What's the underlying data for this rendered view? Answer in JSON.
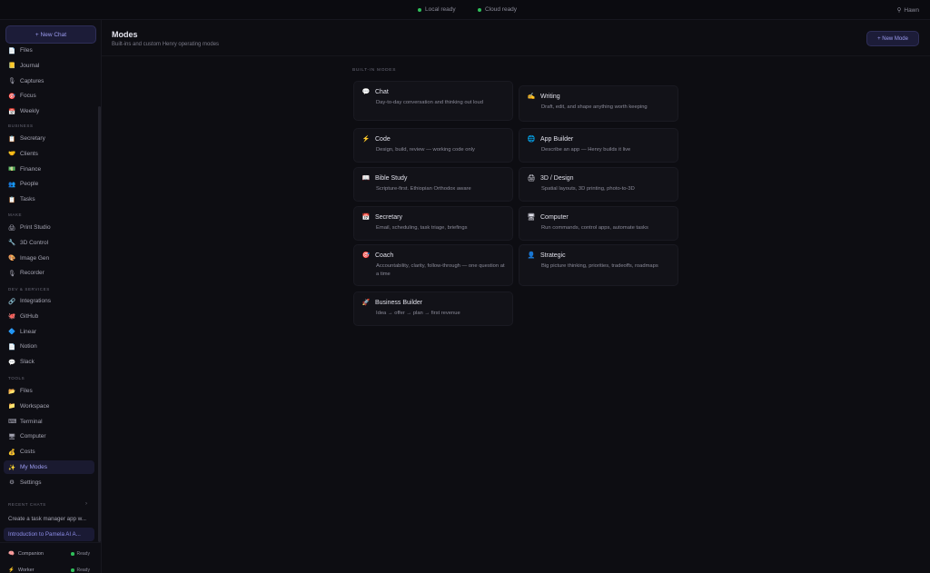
{
  "topbar": {
    "local_status": "Local ready",
    "cloud_status": "Cloud ready",
    "user": "Hawn",
    "status_color": "#2fbf5a"
  },
  "sidebar": {
    "new_chat": "+ New Chat",
    "top_items": [
      {
        "icon": "file-icon",
        "glyph": "📄",
        "label": "Files"
      },
      {
        "icon": "journal-icon",
        "glyph": "📒",
        "label": "Journal"
      },
      {
        "icon": "captures-icon",
        "glyph": "🎙",
        "label": "Captures"
      },
      {
        "icon": "focus-icon",
        "glyph": "🎯",
        "label": "Focus"
      },
      {
        "icon": "calendar-icon",
        "glyph": "📅",
        "label": "Weekly"
      }
    ],
    "business_label": "BUSINESS",
    "business_items": [
      {
        "icon": "secretary-icon",
        "glyph": "📋",
        "label": "Secretary"
      },
      {
        "icon": "handshake-icon",
        "glyph": "🤝",
        "label": "Clients"
      },
      {
        "icon": "finance-icon",
        "glyph": "💵",
        "label": "Finance"
      },
      {
        "icon": "people-icon",
        "glyph": "👥",
        "label": "People"
      },
      {
        "icon": "tasks-icon",
        "glyph": "📋",
        "label": "Tasks"
      }
    ],
    "make_label": "MAKE",
    "make_items": [
      {
        "icon": "printer-icon",
        "glyph": "🖨",
        "label": "Print Studio"
      },
      {
        "icon": "wrench-icon",
        "glyph": "🔧",
        "label": "3D Control"
      },
      {
        "icon": "image-icon",
        "glyph": "🎨",
        "label": "Image Gen"
      },
      {
        "icon": "microphone-icon",
        "glyph": "🎙",
        "label": "Recorder"
      }
    ],
    "dev_label": "DEV & SERVICES",
    "dev_items": [
      {
        "icon": "link-icon",
        "glyph": "🔗",
        "label": "Integrations"
      },
      {
        "icon": "github-icon",
        "glyph": "🐙",
        "label": "GitHub"
      },
      {
        "icon": "linear-icon",
        "glyph": "🔷",
        "label": "Linear"
      },
      {
        "icon": "notion-icon",
        "glyph": "📄",
        "label": "Notion"
      },
      {
        "icon": "slack-icon",
        "glyph": "💬",
        "label": "Slack"
      }
    ],
    "tools_label": "TOOLS",
    "tools_items": [
      {
        "icon": "files-icon",
        "glyph": "📂",
        "label": "Files"
      },
      {
        "icon": "folder-icon",
        "glyph": "📁",
        "label": "Workspace"
      },
      {
        "icon": "terminal-icon",
        "glyph": "⌨",
        "label": "Terminal"
      },
      {
        "icon": "computer-icon",
        "glyph": "🖥",
        "label": "Computer"
      },
      {
        "icon": "costs-icon",
        "glyph": "💰",
        "label": "Costs"
      },
      {
        "icon": "sparkles-icon",
        "glyph": "✨",
        "label": "My Modes"
      },
      {
        "icon": "gear-icon",
        "glyph": "⚙",
        "label": "Settings"
      }
    ],
    "recent_label": "RECENT CHATS",
    "recent_chevron": "›",
    "recent_items": [
      "Create a task manager app w...",
      "Introduction to Pamela AI A..."
    ],
    "agents": [
      {
        "icon": "brain-icon",
        "glyph": "🧠",
        "name": "Companion",
        "status": "Ready"
      },
      {
        "icon": "lightning-icon",
        "glyph": "⚡",
        "name": "Worker",
        "status": "Ready"
      }
    ]
  },
  "main": {
    "title": "Modes",
    "subtitle": "Built-ins and custom Henry operating modes",
    "new_mode": "+ New Mode",
    "builtin_label": "BUILT-IN MODES",
    "cards": [
      {
        "icon": "speech-bubble-icon",
        "glyph": "💬",
        "title": "Chat",
        "desc": "Day-to-day conversation and thinking out loud"
      },
      {
        "icon": "pen-icon",
        "glyph": "✍",
        "title": "Writing",
        "desc": "Draft, edit, and shape anything worth keeping"
      },
      {
        "icon": "lightning-icon",
        "glyph": "⚡",
        "title": "Code",
        "desc": "Design, build, review — working code only"
      },
      {
        "icon": "globe-icon",
        "glyph": "🌐",
        "title": "App Builder",
        "desc": "Describe an app — Henry builds it live"
      },
      {
        "icon": "book-icon",
        "glyph": "📖",
        "title": "Bible Study",
        "desc": "Scripture-first. Ethiopian Orthodox aware"
      },
      {
        "icon": "printer-icon",
        "glyph": "🖨",
        "title": "3D / Design",
        "desc": "Spatial layouts, 3D printing, photo-to-3D"
      },
      {
        "icon": "calendar-icon",
        "glyph": "📅",
        "title": "Secretary",
        "desc": "Email, scheduling, task triage, briefings"
      },
      {
        "icon": "computer-icon",
        "glyph": "🖥",
        "title": "Computer",
        "desc": "Run commands, control apps, automate tasks"
      },
      {
        "icon": "target-icon",
        "glyph": "🎯",
        "title": "Coach",
        "desc": "Accountability, clarity, follow-through — one question at a time"
      },
      {
        "icon": "person-icon",
        "glyph": "👤",
        "title": "Strategic",
        "desc": "Big picture thinking, priorities, tradeoffs, roadmaps"
      },
      {
        "icon": "rocket-icon",
        "glyph": "🚀",
        "title": "Business Builder",
        "desc": "Idea → offer → plan → first revenue"
      }
    ]
  }
}
